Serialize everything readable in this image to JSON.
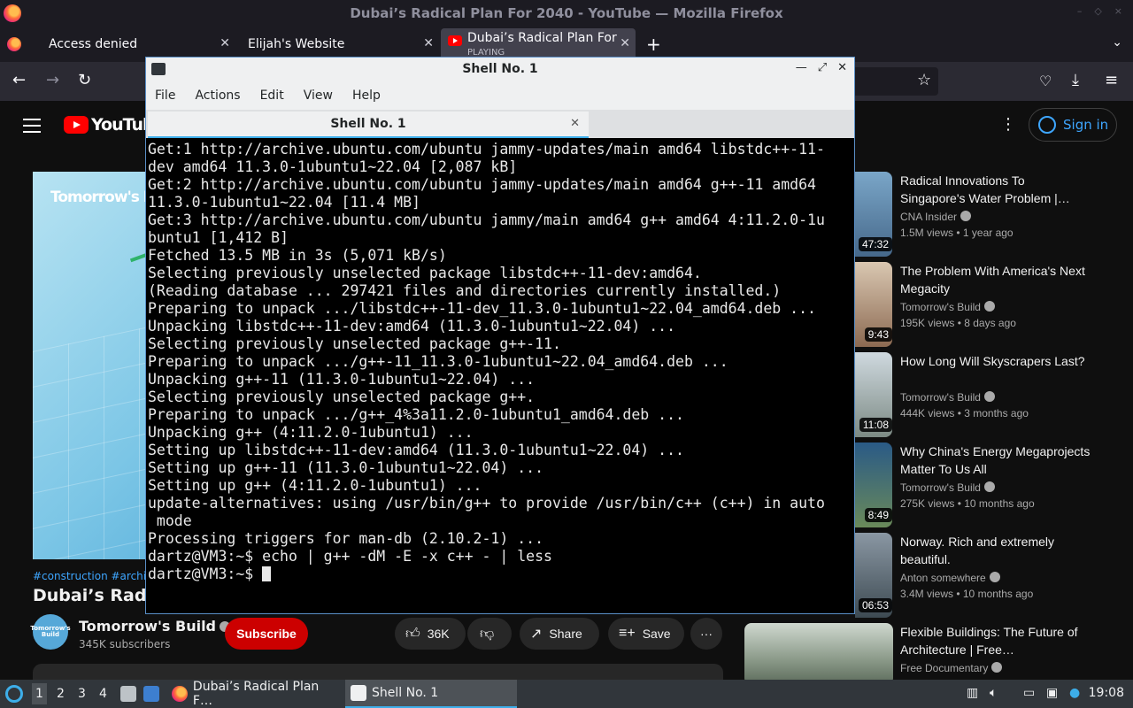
{
  "firefox": {
    "window_title": "Dubai’s Radical Plan For 2040 - YouTube — Mozilla Firefox",
    "tabs": [
      {
        "label": "Access denied"
      },
      {
        "label": "Elijah's Website"
      },
      {
        "label": "Dubai’s Radical Plan For",
        "status": "PLAYING"
      }
    ],
    "new_tab": "+",
    "back": "←",
    "forward": "→",
    "reload": "↻"
  },
  "youtube": {
    "logo_text": "YouTube",
    "sign_in": "Sign in",
    "video_brand": "Tomorrow's Build",
    "hashtags": "#construction #architec",
    "title": "Dubai’s Radical",
    "channel": {
      "name": "Tomorrow's Build",
      "subscribers": "345K subscribers",
      "avatar_text": "Tomorrow's Build"
    },
    "subscribe": "Subscribe",
    "likes": "36K",
    "share": "Share",
    "save": "Save",
    "more": "···",
    "recommendations": [
      {
        "title": "Radical Innovations To Singapore's Water Problem |…",
        "channel": "CNA Insider",
        "meta": "1.5M views • 1 year ago",
        "duration": "47:32"
      },
      {
        "title": "The Problem With America's Next Megacity",
        "channel": "Tomorrow's Build",
        "meta": "195K views • 8 days ago",
        "duration": "9:43"
      },
      {
        "title": "How Long Will Skyscrapers Last?",
        "channel": "Tomorrow's Build",
        "meta": "444K views • 3 months ago",
        "duration": "11:08"
      },
      {
        "title": "Why China's Energy Megaprojects Matter To Us All",
        "channel": "Tomorrow's Build",
        "meta": "275K views • 10 months ago",
        "duration": "8:49"
      },
      {
        "title": "Norway. Rich and extremely beautiful.",
        "channel": "Anton somewhere",
        "meta": "3.4M views • 10 months ago",
        "duration": "06:53"
      },
      {
        "title": "Flexible Buildings: The Future of Architecture | Free…",
        "channel": "Free Documentary",
        "meta": "",
        "duration": ""
      }
    ]
  },
  "terminal": {
    "window_title": "Shell No. 1",
    "menu": [
      "File",
      "Actions",
      "Edit",
      "View",
      "Help"
    ],
    "tab_label": "Shell No. 1",
    "lines": [
      "Get:1 http://archive.ubuntu.com/ubuntu jammy-updates/main amd64 libstdc++-11-",
      "dev amd64 11.3.0-1ubuntu1~22.04 [2,087 kB]",
      "Get:2 http://archive.ubuntu.com/ubuntu jammy-updates/main amd64 g++-11 amd64",
      "11.3.0-1ubuntu1~22.04 [11.4 MB]",
      "Get:3 http://archive.ubuntu.com/ubuntu jammy/main amd64 g++ amd64 4:11.2.0-1u",
      "buntu1 [1,412 B]",
      "Fetched 13.5 MB in 3s (5,071 kB/s)",
      "Selecting previously unselected package libstdc++-11-dev:amd64.",
      "(Reading database ... 297421 files and directories currently installed.)",
      "Preparing to unpack .../libstdc++-11-dev_11.3.0-1ubuntu1~22.04_amd64.deb ...",
      "Unpacking libstdc++-11-dev:amd64 (11.3.0-1ubuntu1~22.04) ...",
      "Selecting previously unselected package g++-11.",
      "Preparing to unpack .../g++-11_11.3.0-1ubuntu1~22.04_amd64.deb ...",
      "Unpacking g++-11 (11.3.0-1ubuntu1~22.04) ...",
      "Selecting previously unselected package g++.",
      "Preparing to unpack .../g++_4%3a11.2.0-1ubuntu1_amd64.deb ...",
      "Unpacking g++ (4:11.2.0-1ubuntu1) ...",
      "Setting up libstdc++-11-dev:amd64 (11.3.0-1ubuntu1~22.04) ...",
      "Setting up g++-11 (11.3.0-1ubuntu1~22.04) ...",
      "Setting up g++ (4:11.2.0-1ubuntu1) ...",
      "update-alternatives: using /usr/bin/g++ to provide /usr/bin/c++ (c++) in auto",
      " mode",
      "Processing triggers for man-db (2.10.2-1) ...",
      "dartz@VM3:~$ echo | g++ -dM -E -x c++ - | less"
    ],
    "prompt": "dartz@VM3:~$ "
  },
  "taskbar": {
    "desktops": [
      "1",
      "2",
      "3",
      "4"
    ],
    "tasks": [
      {
        "label": "Dubai’s Radical Plan F…"
      },
      {
        "label": "Shell No. 1"
      }
    ],
    "clock": "19:08"
  },
  "colors": {
    "yt_red": "#ff0000",
    "subscribe_bg": "#cc0000",
    "link_blue": "#3ea6ff",
    "kde_accent": "#3daee9"
  }
}
